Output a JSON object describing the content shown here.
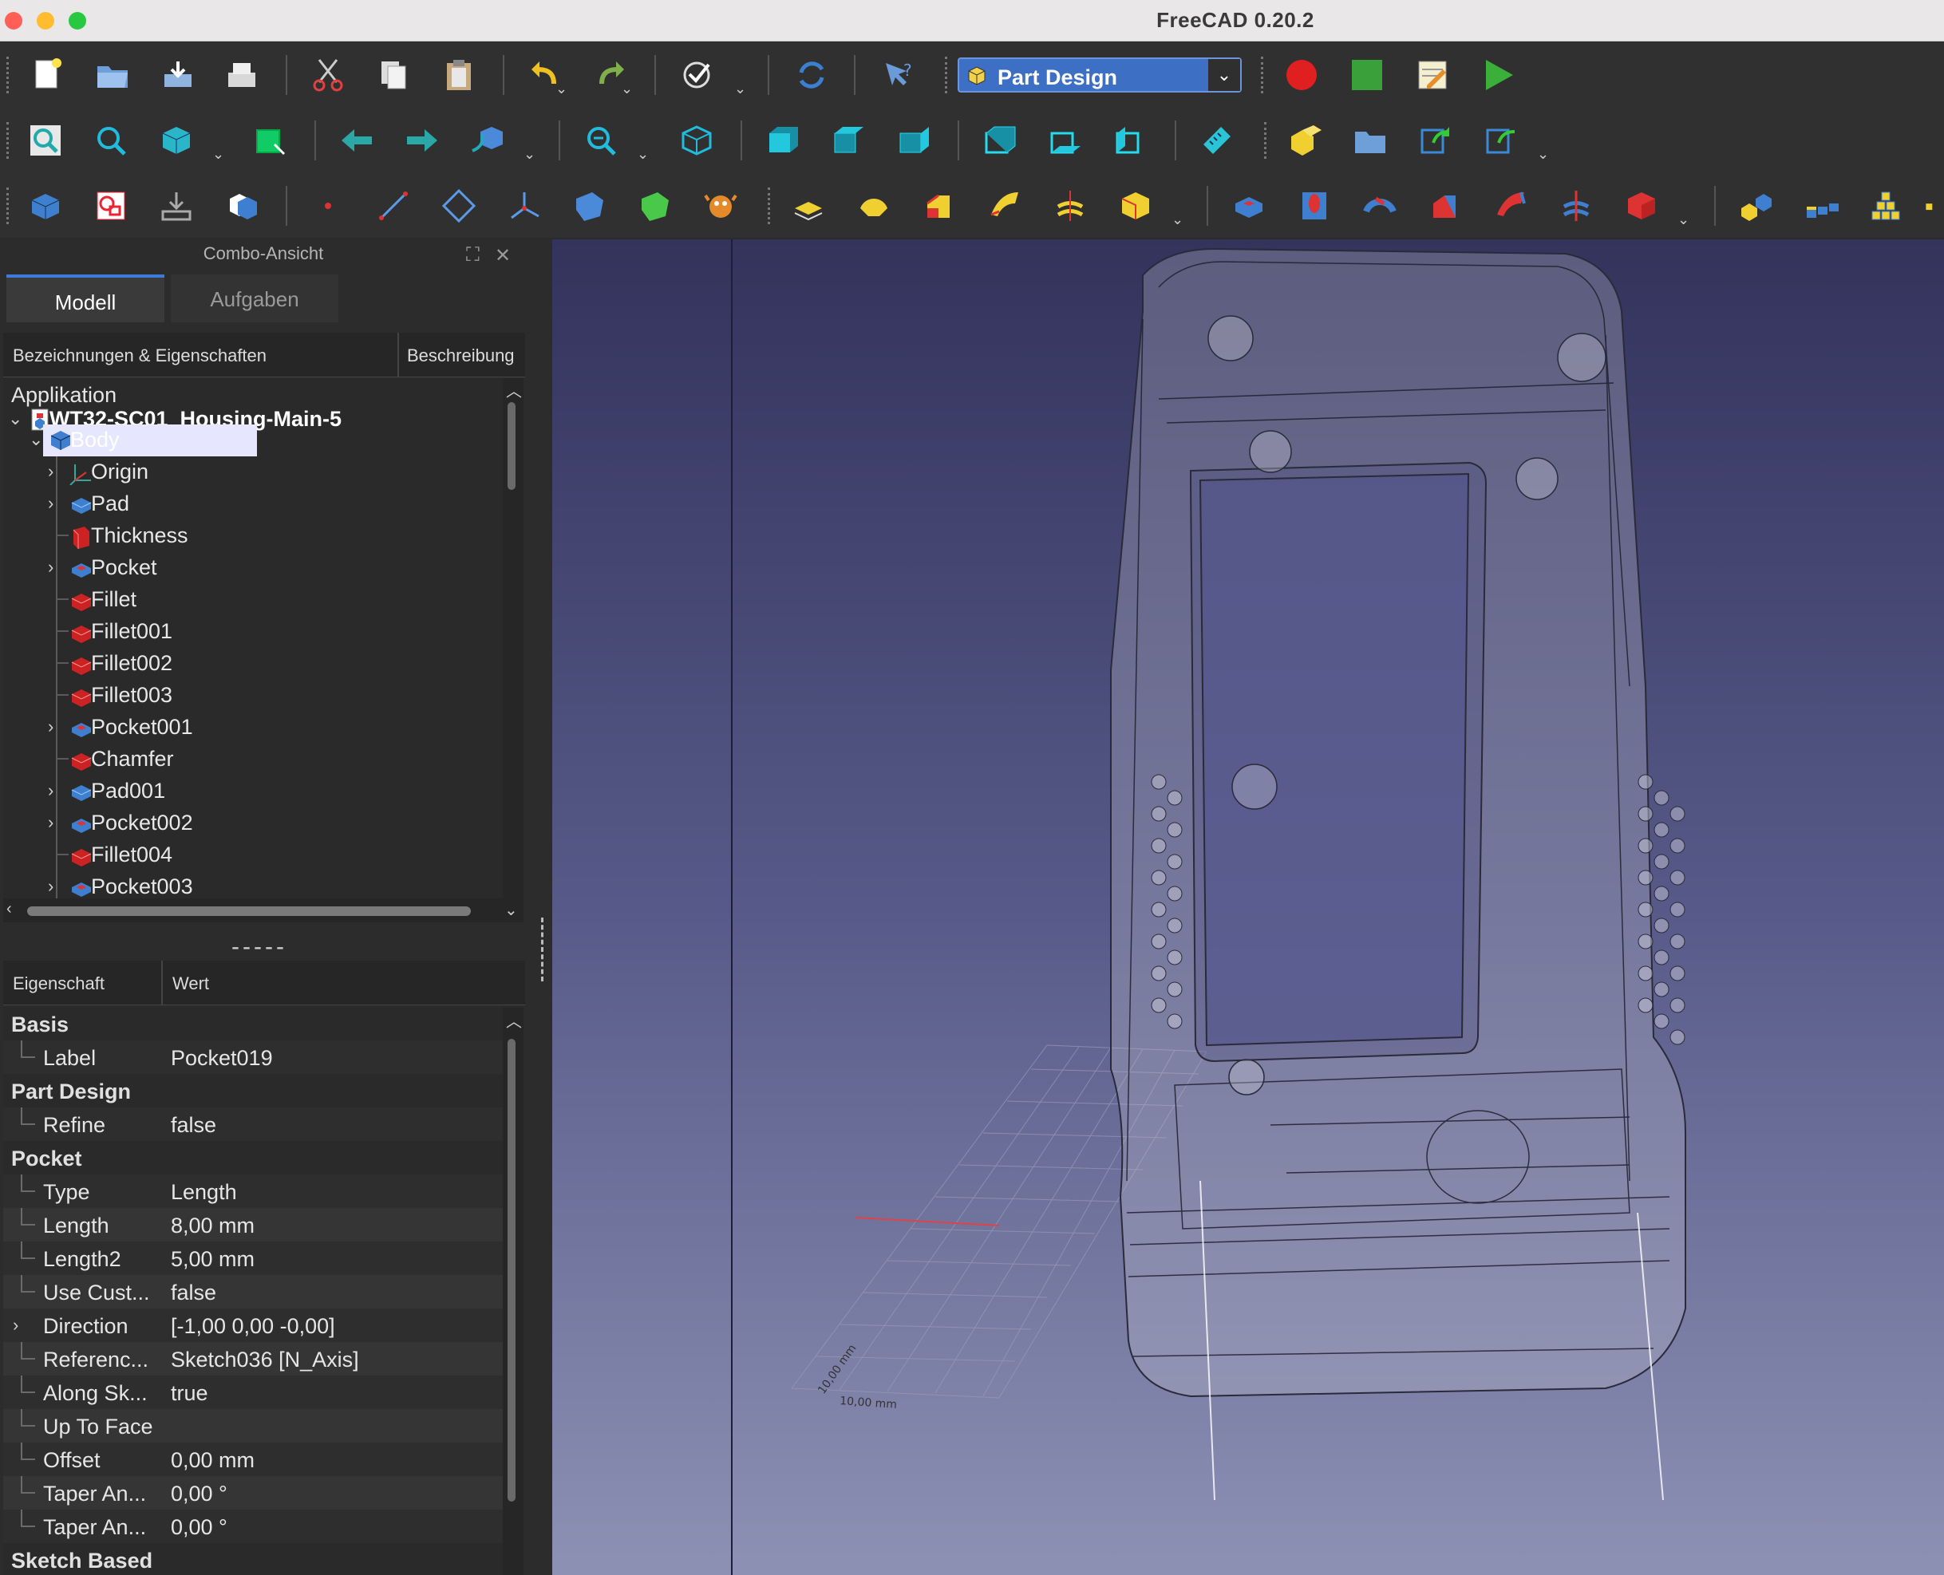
{
  "window": {
    "title": "FreeCAD 0.20.2"
  },
  "workbench": {
    "selected": "Part Design"
  },
  "combo": {
    "title": "Combo-Ansicht",
    "tabs": [
      {
        "label": "Modell"
      },
      {
        "label": "Aufgaben"
      }
    ],
    "tree_header": {
      "col1": "Bezeichnungen & Eigenschaften",
      "col2": "Beschreibung"
    },
    "tree": {
      "root": "Applikation",
      "document": "WT32-SC01_Housing-Main-5",
      "body": "Body",
      "items": [
        {
          "label": "Origin",
          "expandable": true,
          "icon": "origin-icon"
        },
        {
          "label": "Pad",
          "expandable": true,
          "icon": "pad-icon"
        },
        {
          "label": "Thickness",
          "expandable": false,
          "icon": "thickness-icon"
        },
        {
          "label": "Pocket",
          "expandable": true,
          "icon": "pocket-icon"
        },
        {
          "label": "Fillet",
          "expandable": false,
          "icon": "fillet-icon"
        },
        {
          "label": "Fillet001",
          "expandable": false,
          "icon": "fillet-icon"
        },
        {
          "label": "Fillet002",
          "expandable": false,
          "icon": "fillet-icon"
        },
        {
          "label": "Fillet003",
          "expandable": false,
          "icon": "fillet-icon"
        },
        {
          "label": "Pocket001",
          "expandable": true,
          "icon": "pocket-icon"
        },
        {
          "label": "Chamfer",
          "expandable": false,
          "icon": "chamfer-icon"
        },
        {
          "label": "Pad001",
          "expandable": true,
          "icon": "pad-icon"
        },
        {
          "label": "Pocket002",
          "expandable": true,
          "icon": "pocket-icon"
        },
        {
          "label": "Fillet004",
          "expandable": false,
          "icon": "fillet-icon"
        },
        {
          "label": "Pocket003",
          "expandable": true,
          "icon": "pocket-icon"
        }
      ]
    },
    "splitter": "-----",
    "prop_header": {
      "col1": "Eigenschaft",
      "col2": "Wert"
    },
    "properties": [
      {
        "group": "Basis"
      },
      {
        "name": "Label",
        "value": "Pocket019"
      },
      {
        "group": "Part Design"
      },
      {
        "name": "Refine",
        "value": "false"
      },
      {
        "group": "Pocket"
      },
      {
        "name": "Type",
        "value": "Length"
      },
      {
        "name": "Length",
        "value": "8,00 mm"
      },
      {
        "name": "Length2",
        "value": "5,00 mm"
      },
      {
        "name": "Use Cust...",
        "value": "false"
      },
      {
        "name": "Direction",
        "value": "[-1,00 0,00 -0,00]",
        "expandable": true
      },
      {
        "name": "Referenc...",
        "value": "Sketch036 [N_Axis]"
      },
      {
        "name": "Along Sk...",
        "value": "true"
      },
      {
        "name": "Up To Face",
        "value": ""
      },
      {
        "name": "Offset",
        "value": "0,00 mm"
      },
      {
        "name": "Taper An...",
        "value": "0,00 °"
      },
      {
        "name": "Taper An...",
        "value": "0,00 °"
      },
      {
        "group": "Sketch Based"
      }
    ]
  },
  "viewport": {
    "grid_labels": {
      "x": "10,00 mm",
      "y": "10,00 mm"
    }
  },
  "colors": {
    "accent": "#3d7bd9",
    "selection": "#e6e6ff",
    "workbench_bg": "#3d6fc4",
    "record_macro": "#e02020",
    "stop_macro": "#3aa03a",
    "view_bg_top": "#33335c",
    "view_bg_bottom": "#8d91b4"
  }
}
